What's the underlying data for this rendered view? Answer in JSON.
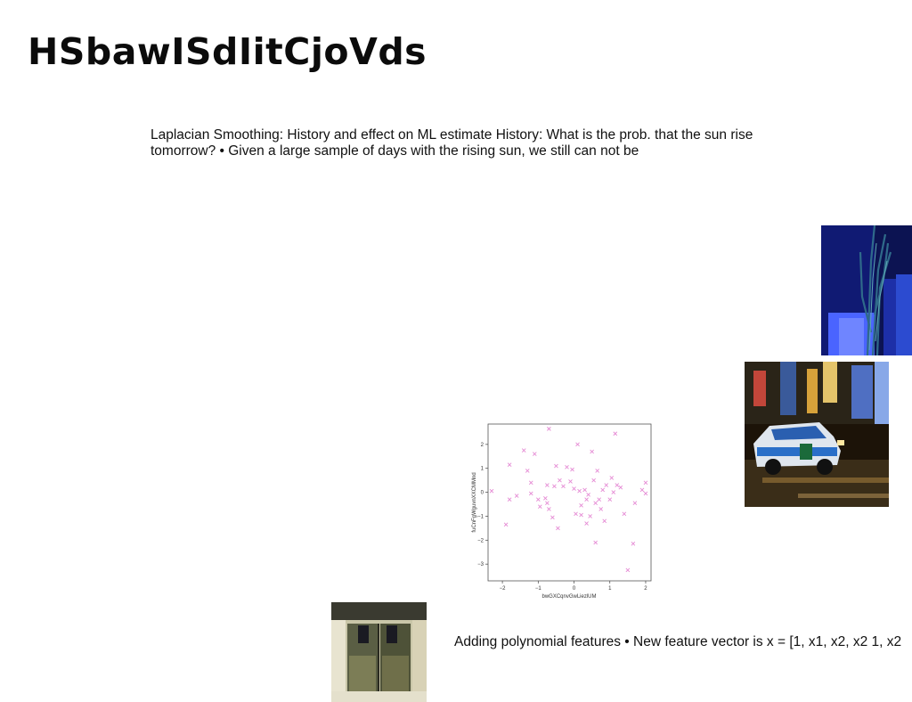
{
  "slide": {
    "title": "HSbawISdIitCjoVds",
    "paragraph": "Laplacian Smoothing: History and effect on ML estimate History: What is the prob. that the sun rise tomorrow? • Given a large sample of days with the rising sun, we still can not be",
    "caption": "Adding polynomial features • New feature vector is x = [1, x1, x2, x2 1, x2"
  },
  "images": {
    "photo_a": "night-building-plant-photo",
    "photo_b": "city-taxi-motion-photo",
    "photo_c": "temple-doorway-photo"
  },
  "chart_data": {
    "type": "scatter",
    "xlabel": "bwGXCqnvGwLiezlUM",
    "ylabel": "fuCnFgWguvnXXCMMnd",
    "xlim": [
      -2.4,
      2.15
    ],
    "ylim": [
      -3.7,
      2.85
    ],
    "xticks": [
      -2,
      -1,
      0,
      1,
      2
    ],
    "yticks": [
      -3,
      -2,
      -1,
      0,
      1,
      2
    ],
    "marker": "x",
    "color": "#e58ad4",
    "points": [
      [
        -2.3,
        0.05
      ],
      [
        -1.9,
        -1.35
      ],
      [
        -1.8,
        1.15
      ],
      [
        -1.8,
        -0.3
      ],
      [
        -1.6,
        -0.15
      ],
      [
        -1.4,
        1.75
      ],
      [
        -1.3,
        0.9
      ],
      [
        -1.2,
        0.4
      ],
      [
        -1.2,
        -0.05
      ],
      [
        -1.1,
        1.6
      ],
      [
        -1.0,
        -0.3
      ],
      [
        -0.95,
        -0.6
      ],
      [
        -0.8,
        -0.25
      ],
      [
        -0.75,
        0.3
      ],
      [
        -0.75,
        -0.45
      ],
      [
        -0.7,
        2.65
      ],
      [
        -0.7,
        -0.7
      ],
      [
        -0.6,
        -1.05
      ],
      [
        -0.5,
        1.1
      ],
      [
        -0.45,
        -1.5
      ],
      [
        -0.4,
        0.5
      ],
      [
        -0.3,
        0.25
      ],
      [
        -0.2,
        1.05
      ],
      [
        -0.1,
        0.45
      ],
      [
        -0.05,
        0.95
      ],
      [
        0.0,
        0.15
      ],
      [
        0.05,
        -0.9
      ],
      [
        0.1,
        2.0
      ],
      [
        0.15,
        0.05
      ],
      [
        0.2,
        -0.55
      ],
      [
        0.2,
        -0.95
      ],
      [
        0.3,
        0.1
      ],
      [
        0.35,
        -0.3
      ],
      [
        0.4,
        -0.1
      ],
      [
        0.45,
        -1.0
      ],
      [
        0.5,
        1.7
      ],
      [
        0.55,
        0.5
      ],
      [
        0.6,
        -0.45
      ],
      [
        0.6,
        -2.1
      ],
      [
        0.7,
        -0.3
      ],
      [
        0.75,
        -0.7
      ],
      [
        0.8,
        0.1
      ],
      [
        0.85,
        -1.2
      ],
      [
        0.9,
        0.3
      ],
      [
        1.0,
        -0.3
      ],
      [
        1.05,
        0.6
      ],
      [
        1.1,
        0.0
      ],
      [
        1.15,
        2.45
      ],
      [
        1.2,
        0.3
      ],
      [
        1.3,
        0.2
      ],
      [
        1.4,
        -0.9
      ],
      [
        1.5,
        -3.25
      ],
      [
        1.65,
        -2.15
      ],
      [
        1.7,
        -0.45
      ],
      [
        1.9,
        0.1
      ],
      [
        2.0,
        0.4
      ],
      [
        2.0,
        -0.05
      ],
      [
        0.65,
        0.9
      ],
      [
        -0.55,
        0.25
      ],
      [
        0.35,
        -1.3
      ]
    ]
  }
}
